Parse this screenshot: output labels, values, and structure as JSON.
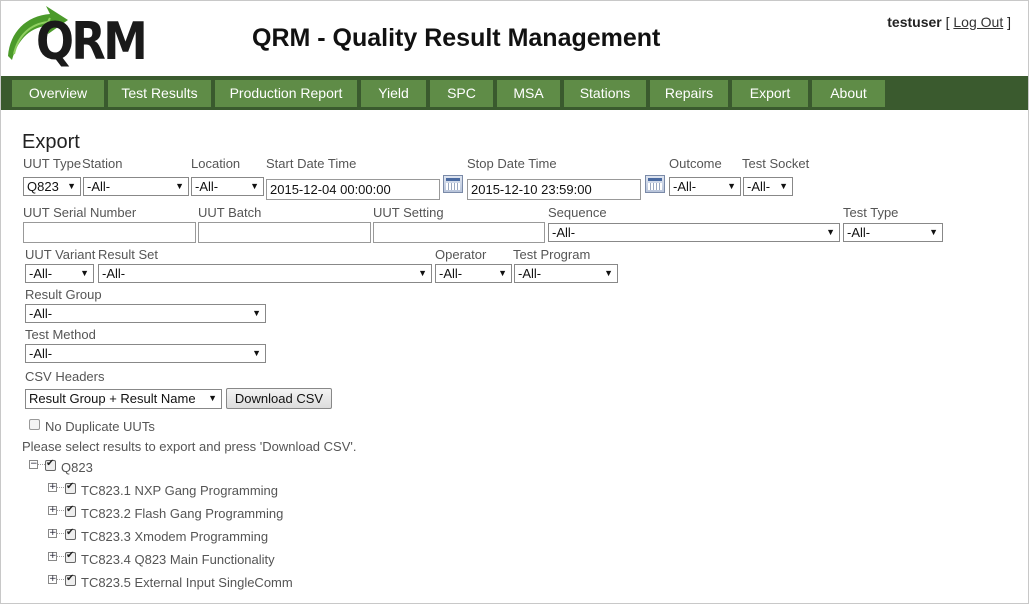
{
  "header": {
    "logo_text": "QRM",
    "title": "QRM - Quality Result Management",
    "username": "testuser",
    "bracket_open": "[",
    "logout_label": "Log Out",
    "bracket_close": "]"
  },
  "nav": {
    "items": [
      "Overview",
      "Test Results",
      "Production Report",
      "Yield",
      "SPC",
      "MSA",
      "Stations",
      "Repairs",
      "Export",
      "About"
    ]
  },
  "page": {
    "heading": "Export",
    "filters": {
      "uut_type_label": "UUT Type",
      "uut_type_value": "Q823",
      "station_label": "Station",
      "station_value": "-All-",
      "location_label": "Location",
      "location_value": "-All-",
      "start_label": "Start Date Time",
      "start_value": "2015-12-04 00:00:00",
      "stop_label": "Stop Date Time",
      "stop_value": "2015-12-10 23:59:00",
      "outcome_label": "Outcome",
      "outcome_value": "-All-",
      "socket_label": "Test Socket",
      "socket_value": "-All-",
      "serial_label": "UUT Serial Number",
      "serial_value": "",
      "batch_label": "UUT Batch",
      "batch_value": "",
      "setting_label": "UUT Setting",
      "setting_value": "",
      "sequence_label": "Sequence",
      "sequence_value": "-All-",
      "test_type_label": "Test Type",
      "test_type_value": "-All-",
      "variant_label": "UUT Variant",
      "variant_value": "-All-",
      "result_set_label": "Result Set",
      "result_set_value": "-All-",
      "operator_label": "Operator",
      "operator_value": "-All-",
      "program_label": "Test Program",
      "program_value": "-All-",
      "result_group_label": "Result Group",
      "result_group_value": "-All-",
      "method_label": "Test Method",
      "method_value": "-All-",
      "csv_headers_label": "CSV Headers",
      "csv_headers_value": "Result Group + Result Name"
    },
    "download_label": "Download CSV",
    "no_dup_label": "No Duplicate UUTs",
    "instructions": "Please select results to export and press 'Download CSV'.",
    "tree": {
      "root": "Q823",
      "children": [
        "TC823.1 NXP Gang Programming",
        "TC823.2 Flash Gang Programming",
        "TC823.3 Xmodem Programming",
        "TC823.4 Q823 Main Functionality",
        "TC823.5 External Input SingleComm"
      ]
    }
  },
  "colors": {
    "nav_bg": "#3a5a2e",
    "nav_item": "#5f8c47",
    "logo_arrow": "#4b9a2a"
  },
  "icons": {
    "calendar": "calendar-icon",
    "expand": "plus-box-icon",
    "collapse": "minus-box-icon",
    "dropdown": "dropdown-arrow-icon"
  }
}
